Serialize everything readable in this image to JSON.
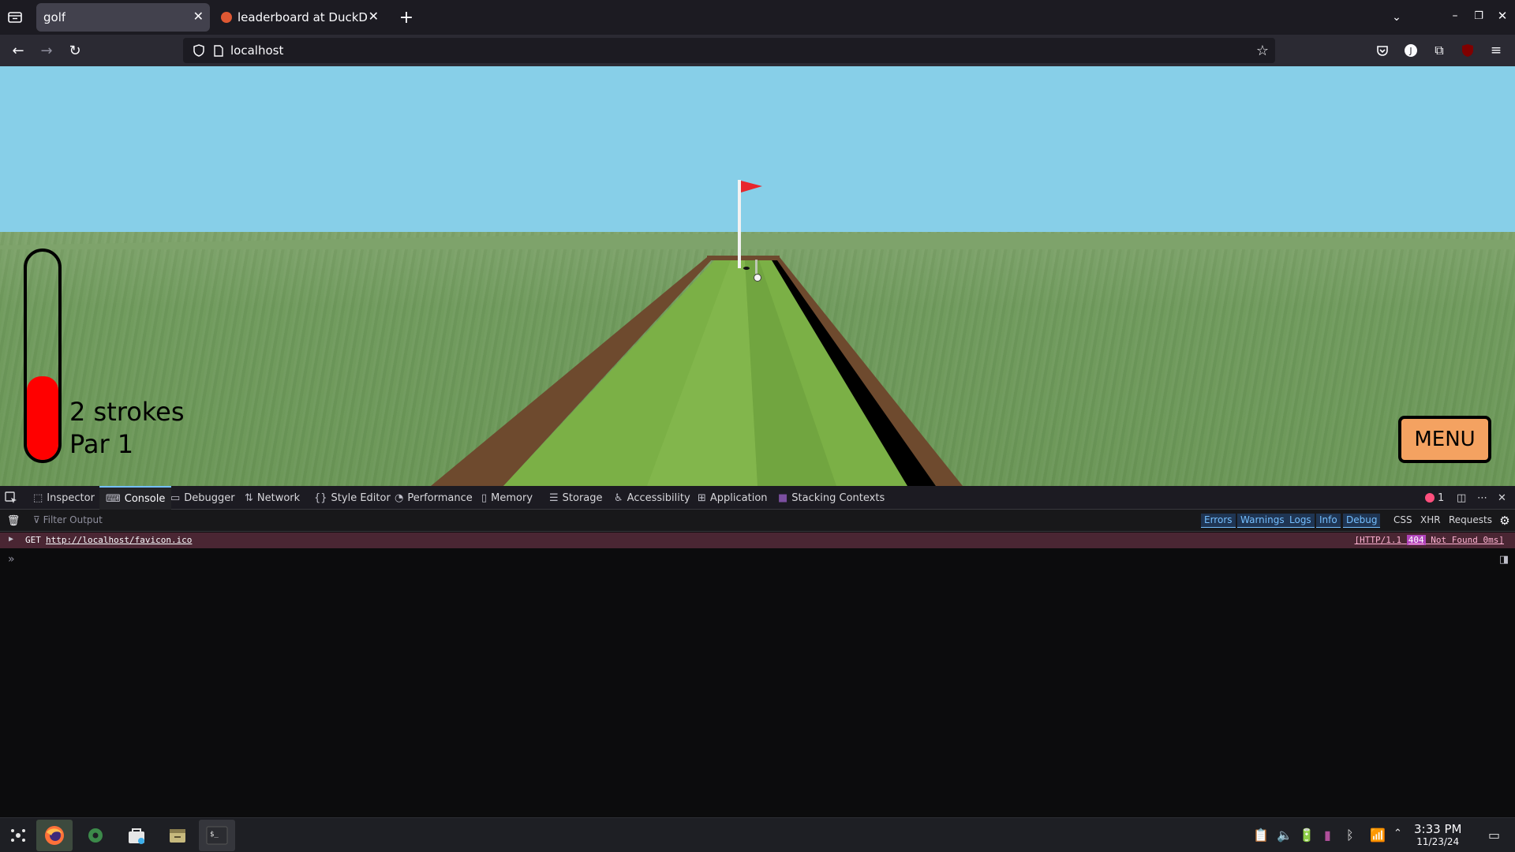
{
  "browser": {
    "tabs": [
      {
        "title": "golf",
        "active": true
      },
      {
        "title": "leaderboard at DuckDuckGo",
        "active": false
      }
    ],
    "url": "localhost"
  },
  "game": {
    "strokes_text": "2 strokes",
    "par_text": "Par 1",
    "menu_label": "MENU",
    "power_level": 0.4,
    "colors": {
      "sky": "#87cfe8",
      "grass": "#6f9a5c",
      "fairway": "#7bb046",
      "wall": "#6e4a2e",
      "power": "#ff0000",
      "menu": "#f4a261",
      "flag": "#e8262c"
    }
  },
  "devtools": {
    "tabs": [
      {
        "label": "Inspector",
        "icon": "inspector-icon"
      },
      {
        "label": "Console",
        "icon": "console-icon",
        "selected": true
      },
      {
        "label": "Debugger",
        "icon": "debugger-icon"
      },
      {
        "label": "Network",
        "icon": "network-icon"
      },
      {
        "label": "Style Editor",
        "icon": "style-editor-icon"
      },
      {
        "label": "Performance",
        "icon": "performance-icon"
      },
      {
        "label": "Memory",
        "icon": "memory-icon"
      },
      {
        "label": "Storage",
        "icon": "storage-icon"
      },
      {
        "label": "Accessibility",
        "icon": "accessibility-icon"
      },
      {
        "label": "Application",
        "icon": "application-icon"
      },
      {
        "label": "Stacking Contexts",
        "icon": "stacking-contexts-icon"
      }
    ],
    "error_count": "1",
    "filter_placeholder": "Filter Output",
    "filters": [
      {
        "label": "Errors",
        "on": true
      },
      {
        "label": "Warnings",
        "on": true
      },
      {
        "label": "Logs",
        "on": true
      },
      {
        "label": "Info",
        "on": true
      },
      {
        "label": "Debug",
        "on": true
      },
      {
        "label": "CSS",
        "on": false
      },
      {
        "label": "XHR",
        "on": false
      },
      {
        "label": "Requests",
        "on": false
      }
    ],
    "message": {
      "method": "GET",
      "url": "http://localhost/favicon.ico",
      "status_prefix": "[HTTP/1.1",
      "status_code": "404",
      "status_suffix": "Not Found 0ms]"
    }
  },
  "taskbar": {
    "time": "3:33 PM",
    "date": "11/23/24"
  }
}
